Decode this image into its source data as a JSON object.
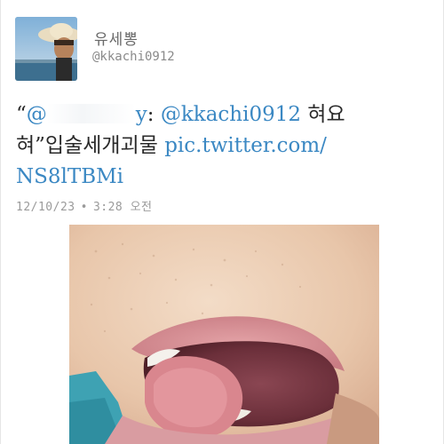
{
  "tweet": {
    "display_name": "유세뽕",
    "handle": "@kkachi0912",
    "text": {
      "open_quote": "“",
      "mention_partial": "@",
      "mention_tail": "y",
      "colon": ": ",
      "mention": "@kkachi0912",
      "word1": " 혀요",
      "line2_prefix": "혀”입술세개괴물 ",
      "link_part1": "pic.twitter.com/",
      "link_part2": "NS8lTBMi"
    },
    "timestamp_date": "12/10/23",
    "timestamp_sep": "•",
    "timestamp_time": "3:28 오전"
  },
  "colors": {
    "link": "#3b88c3",
    "text": "#2a2a2a",
    "meta": "#9a9a9a"
  },
  "icons": {
    "avatar": "profile-photo",
    "photo": "attached-photo"
  }
}
